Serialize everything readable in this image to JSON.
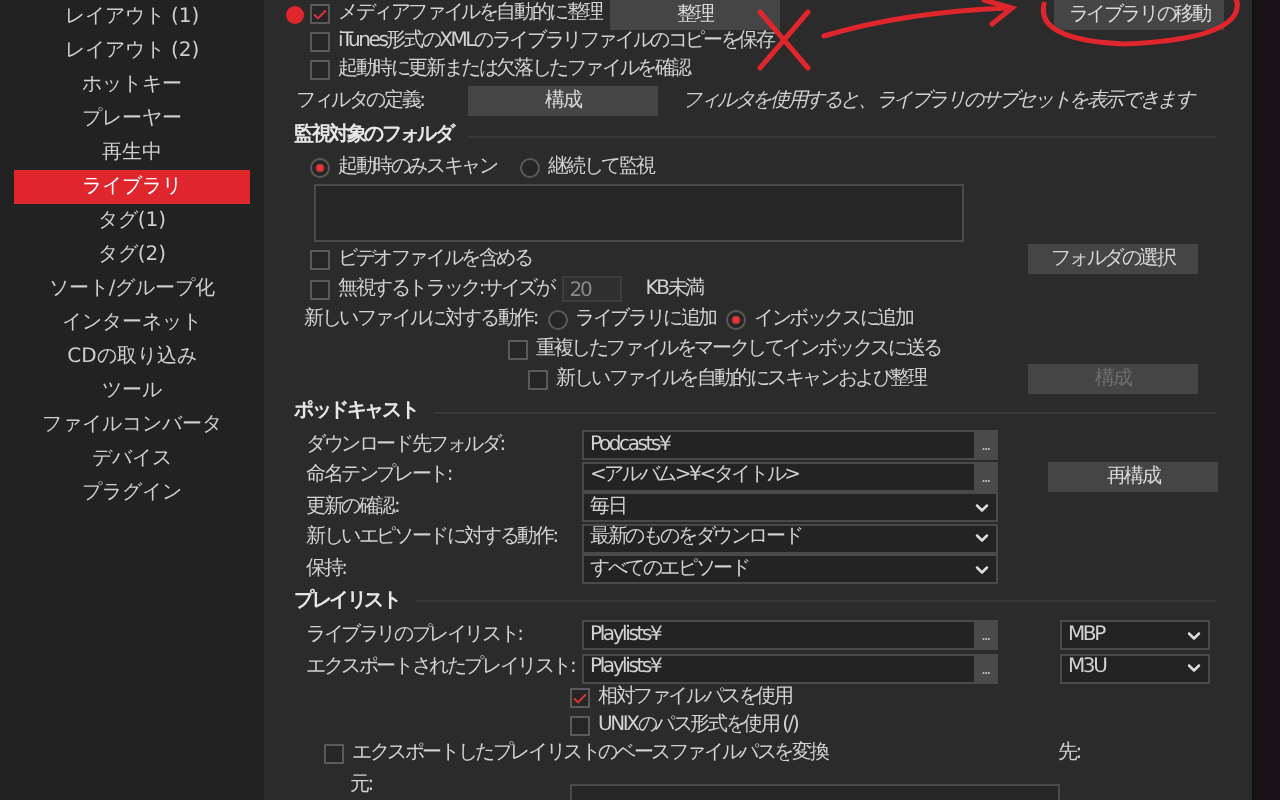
{
  "sidebar": {
    "items": [
      {
        "label": "レイアウト (1)",
        "selected": false
      },
      {
        "label": "レイアウト (2)",
        "selected": false
      },
      {
        "label": "ホットキー",
        "selected": false
      },
      {
        "label": "プレーヤー",
        "selected": false
      },
      {
        "label": "再生中",
        "selected": false
      },
      {
        "label": "ライブラリ",
        "selected": true
      },
      {
        "label": "タグ(1)",
        "selected": false
      },
      {
        "label": "タグ(2)",
        "selected": false
      },
      {
        "label": "ソート/グループ化",
        "selected": false
      },
      {
        "label": "インターネット",
        "selected": false
      },
      {
        "label": "CDの取り込み",
        "selected": false
      },
      {
        "label": "ツール",
        "selected": false
      },
      {
        "label": "ファイルコンバータ",
        "selected": false
      },
      {
        "label": "デバイス",
        "selected": false
      },
      {
        "label": "プラグイン",
        "selected": false
      }
    ]
  },
  "library": {
    "organize": {
      "label": "メディアファイルを自動的に整理",
      "checked": true,
      "button": "整理"
    },
    "move_button": "ライブラリの移動",
    "options": [
      {
        "label": "iTunes形式のXMLのライブラリファイルのコピーを保存",
        "checked": false
      },
      {
        "label": "起動時に更新または欠落したファイルを確認",
        "checked": false
      }
    ],
    "filter": {
      "label": "フィルタの定義:",
      "button": "構成",
      "hint": "フィルタを使用すると、ライブラリのサブセットを表示できます"
    }
  },
  "watch_folders": {
    "title": "監視対象のフォルダ",
    "modes": [
      {
        "label": "起動時のみスキャン",
        "selected": true
      },
      {
        "label": "継続して監視",
        "selected": false
      }
    ],
    "include_video": {
      "label": "ビデオファイルを含める",
      "checked": false
    },
    "choose_button": "フォルダの選択",
    "ignore": {
      "label": "無視するトラック:サイズが",
      "checked": false,
      "value": "20",
      "unit": "KB未満"
    },
    "action_label": "新しいファイルに対する動作:",
    "actions": [
      {
        "label": "ライブラリに追加",
        "selected": false
      },
      {
        "label": "インボックスに追加",
        "selected": true
      }
    ],
    "duplicates": {
      "label": "重複したファイルをマークしてインボックスに送る",
      "checked": false
    },
    "auto_scan": {
      "label": "新しいファイルを自動的にスキャンおよび整理",
      "checked": false
    },
    "configure_button": {
      "label": "構成",
      "disabled": true
    }
  },
  "podcasts": {
    "title": "ポッドキャスト",
    "rebuild_button": "再構成",
    "rows": [
      {
        "label": "ダウンロード先フォルダ:",
        "value": "Podcasts¥",
        "kind": "path",
        "browse": "..."
      },
      {
        "label": "命名テンプレート:",
        "value": "<アルバム>¥<タイトル>",
        "kind": "path",
        "browse": "..."
      },
      {
        "label": "更新の確認:",
        "value": "毎日",
        "kind": "select"
      },
      {
        "label": "新しいエピソードに対する動作:",
        "value": "最新のものをダウンロード",
        "kind": "select"
      },
      {
        "label": "保持:",
        "value": "すべてのエピソード",
        "kind": "select"
      }
    ]
  },
  "playlists": {
    "title": "プレイリスト",
    "rows": [
      {
        "label": "ライブラリのプレイリスト:",
        "value": "Playlists¥",
        "browse": "...",
        "format": "MBP"
      },
      {
        "label": "エクスポートされたプレイリスト:",
        "value": "Playlists¥",
        "browse": "...",
        "format": "M3U"
      }
    ],
    "relative": {
      "label": "相対ファイルパスを使用",
      "checked": true
    },
    "unix": {
      "label": "UNIXのパス形式を使用 (/)",
      "checked": false
    },
    "convert": {
      "label": "エクスポートしたプレイリストのベースファイルパスを変換",
      "checked": false
    },
    "to_label": "先:",
    "from_label": "元:"
  }
}
